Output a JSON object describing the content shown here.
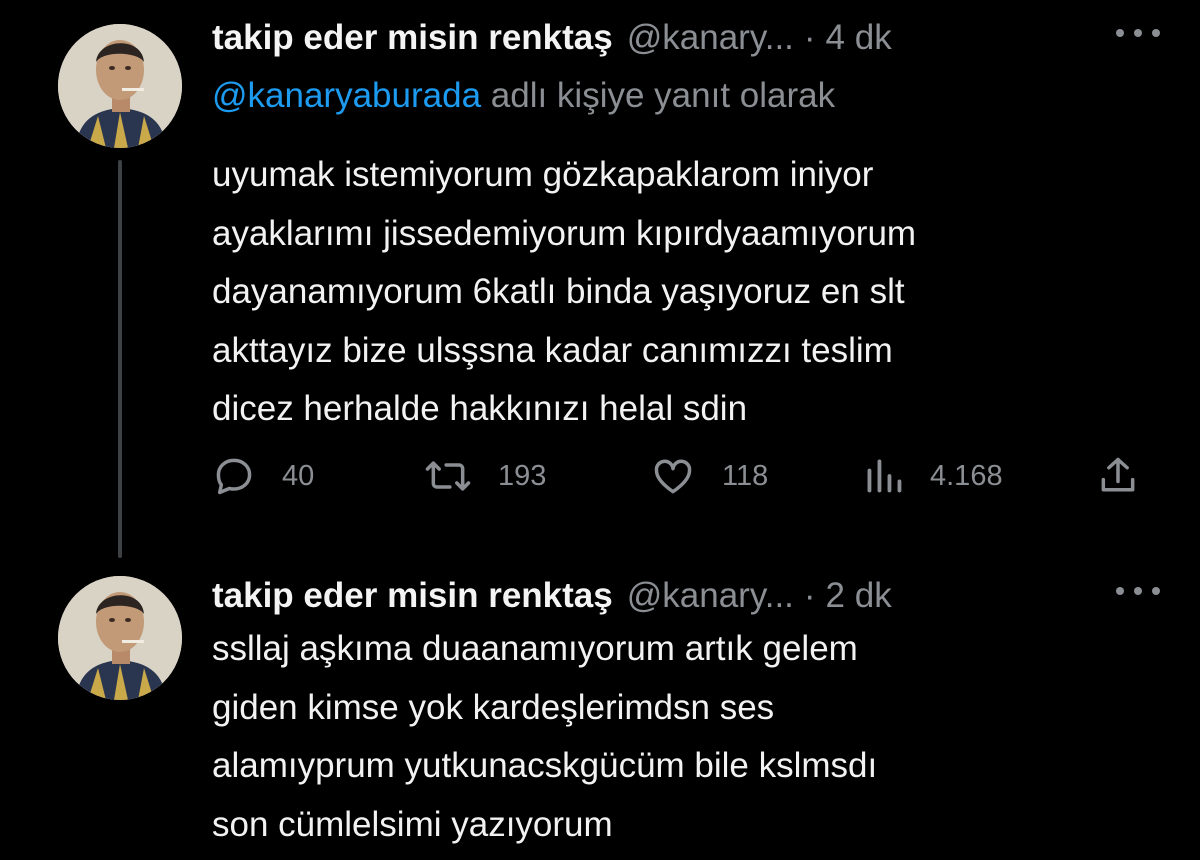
{
  "tweets": [
    {
      "author_name": "takip eder misin renktaş",
      "handle": "@kanary...",
      "separator": "·",
      "time": "4 dk",
      "reply_to_handle": "@kanaryaburada",
      "reply_to_text": "adlı kişiye yanıt olarak",
      "body_lines": [
        "uyumak istemiyorum gözkapaklarom iniyor",
        "ayaklarımı jissedemiyorum kıpırdyaamıyorum",
        "dayanamıyorum 6katlı binda yaşıyoruz en slt",
        "akttayız bize ulsşsna kadar canımızzı teslim",
        "dicez herhalde hakkınızı helal sdin"
      ],
      "stats": {
        "replies": "40",
        "retweets": "193",
        "likes": "118",
        "views": "4.168"
      }
    },
    {
      "author_name": "takip eder misin renktaş",
      "handle": "@kanary...",
      "separator": "·",
      "time": "2 dk",
      "body_lines": [
        "ssllaj aşkıma duaanamıyorum artık gelem",
        "giden kimse yok kardeşlerimdsn ses",
        "alamıyprum yutkunacskgücüm bile kslmsdı",
        "son cümlelsimi yazıyorum"
      ]
    }
  ],
  "icons": {
    "reply": "reply-icon",
    "retweet": "retweet-icon",
    "like": "heart-icon",
    "views": "views-icon",
    "share": "share-icon",
    "more": "more-icon"
  },
  "colors": {
    "background": "#000000",
    "text": "#f2f2f2",
    "muted": "#8b8f94",
    "link": "#1d9bf0",
    "thread_line": "#3e4144"
  }
}
